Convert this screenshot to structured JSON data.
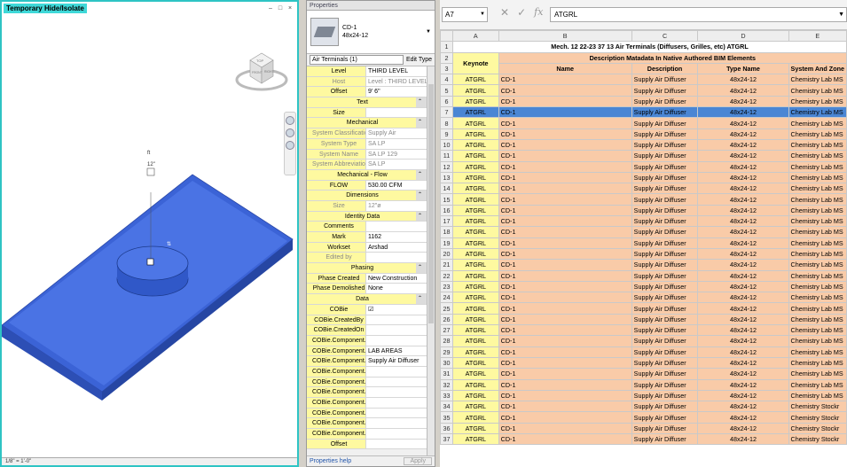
{
  "view": {
    "title": "Temporary Hide/Isolate",
    "controls": [
      "–",
      "□",
      "×"
    ],
    "status": "1/8\" = 1'-0\"",
    "tag_label": "ft",
    "tag_value": "12\""
  },
  "props": {
    "header": "Properties",
    "type_name": "CD-1",
    "type_size": "48x24-12",
    "instance_filter": "Air Terminals (1)",
    "edit_type": "Edit Type",
    "help": "Properties help",
    "apply": "Apply",
    "rows": [
      {
        "k": "Level",
        "v": "THIRD LEVEL"
      },
      {
        "k": "Host",
        "v": "Level : THIRD LEVEL",
        "ro": true
      },
      {
        "k": "Offset",
        "v": "9' 6\""
      },
      {
        "g": "Text"
      },
      {
        "k": "Size",
        "v": ""
      },
      {
        "g": "Mechanical"
      },
      {
        "k": "System Classification",
        "v": "Supply Air",
        "ro": true
      },
      {
        "k": "System Type",
        "v": "SA LP",
        "ro": true
      },
      {
        "k": "System Name",
        "v": "SA LP 129",
        "ro": true
      },
      {
        "k": "System Abbreviation",
        "v": "SA LP",
        "ro": true
      },
      {
        "g": "Mechanical - Flow"
      },
      {
        "k": "FLOW",
        "v": "530.00 CFM"
      },
      {
        "g": "Dimensions"
      },
      {
        "k": "Size",
        "v": "12\"ø",
        "ro": true
      },
      {
        "g": "Identity Data"
      },
      {
        "k": "Comments",
        "v": ""
      },
      {
        "k": "Mark",
        "v": "1162"
      },
      {
        "k": "Workset",
        "v": "Arshad"
      },
      {
        "k": "Edited by",
        "v": "",
        "ro": true
      },
      {
        "g": "Phasing"
      },
      {
        "k": "Phase Created",
        "v": "New Construction"
      },
      {
        "k": "Phase Demolished",
        "v": "None"
      },
      {
        "g": "Data"
      },
      {
        "k": "COBie",
        "v": "☑"
      },
      {
        "k": "COBie.CreatedBy",
        "v": ""
      },
      {
        "k": "COBie.CreatedOn",
        "v": ""
      },
      {
        "k": "COBie.Component....",
        "v": ""
      },
      {
        "k": "COBie.Component.S...",
        "v": "LAB AREAS"
      },
      {
        "k": "COBie.Component....",
        "v": "Supply Air Diffuser"
      },
      {
        "k": "COBie.Component.S...",
        "v": ""
      },
      {
        "k": "COBie.Component.I...",
        "v": ""
      },
      {
        "k": "COBie.Component....",
        "v": ""
      },
      {
        "k": "COBie.Component.T...",
        "v": ""
      },
      {
        "k": "COBie.Component.B...",
        "v": ""
      },
      {
        "k": "COBie.Component....",
        "v": ""
      },
      {
        "k": "COBie.Component....",
        "v": ""
      },
      {
        "k": "Offset",
        "v": ""
      }
    ]
  },
  "excel": {
    "name_box": "A7",
    "formula": "ATGRL",
    "columns": [
      "A",
      "B",
      "C",
      "D",
      "E"
    ],
    "title": "Mech. 12  22-23 37 13 Air Terminals (Diffusers, Grilles, etc)  ATGRL",
    "group_header": "Description Matadata In Native Authored BIM Elements",
    "keynote_header": "Keynote",
    "sub_headers": [
      "Name",
      "Description",
      "Type Name",
      "System And Zone"
    ],
    "selected_row": 7,
    "rows": [
      {
        "n": 4,
        "c": [
          "ATGRL",
          "CD-1",
          "Supply Air Diffuser",
          "48x24-12",
          "Chemistry Lab MS"
        ]
      },
      {
        "n": 5,
        "c": [
          "ATGRL",
          "CD-1",
          "Supply Air Diffuser",
          "48x24-12",
          "Chemistry Lab MS"
        ]
      },
      {
        "n": 6,
        "c": [
          "ATGRL",
          "CD-1",
          "Supply Air Diffuser",
          "48x24-12",
          "Chemistry Lab MS"
        ]
      },
      {
        "n": 7,
        "c": [
          "ATGRL",
          "CD-1",
          "Supply Air Diffuser",
          "48x24-12",
          "Chemistry Lab MS"
        ]
      },
      {
        "n": 8,
        "c": [
          "ATGRL",
          "CD-1",
          "Supply Air Diffuser",
          "48x24-12",
          "Chemistry Lab MS"
        ]
      },
      {
        "n": 9,
        "c": [
          "ATGRL",
          "CD-1",
          "Supply Air Diffuser",
          "48x24-12",
          "Chemistry Lab MS"
        ]
      },
      {
        "n": 10,
        "c": [
          "ATGRL",
          "CD-1",
          "Supply Air Diffuser",
          "48x24-12",
          "Chemistry Lab MS"
        ]
      },
      {
        "n": 11,
        "c": [
          "ATGRL",
          "CD-1",
          "Supply Air Diffuser",
          "48x24-12",
          "Chemistry Lab MS"
        ]
      },
      {
        "n": 12,
        "c": [
          "ATGRL",
          "CD-1",
          "Supply Air Diffuser",
          "48x24-12",
          "Chemistry Lab MS"
        ]
      },
      {
        "n": 13,
        "c": [
          "ATGRL",
          "CD-1",
          "Supply Air Diffuser",
          "48x24-12",
          "Chemistry Lab MS"
        ]
      },
      {
        "n": 14,
        "c": [
          "ATGRL",
          "CD-1",
          "Supply Air Diffuser",
          "48x24-12",
          "Chemistry Lab MS"
        ]
      },
      {
        "n": 15,
        "c": [
          "ATGRL",
          "CD-1",
          "Supply Air Diffuser",
          "48x24-12",
          "Chemistry Lab MS"
        ]
      },
      {
        "n": 16,
        "c": [
          "ATGRL",
          "CD-1",
          "Supply Air Diffuser",
          "48x24-12",
          "Chemistry Lab MS"
        ]
      },
      {
        "n": 17,
        "c": [
          "ATGRL",
          "CD-1",
          "Supply Air Diffuser",
          "48x24-12",
          "Chemistry Lab MS"
        ]
      },
      {
        "n": 18,
        "c": [
          "ATGRL",
          "CD-1",
          "Supply Air Diffuser",
          "48x24-12",
          "Chemistry Lab MS"
        ]
      },
      {
        "n": 19,
        "c": [
          "ATGRL",
          "CD-1",
          "Supply Air Diffuser",
          "48x24-12",
          "Chemistry Lab MS"
        ]
      },
      {
        "n": 20,
        "c": [
          "ATGRL",
          "CD-1",
          "Supply Air Diffuser",
          "48x24-12",
          "Chemistry Lab MS"
        ]
      },
      {
        "n": 21,
        "c": [
          "ATGRL",
          "CD-1",
          "Supply Air Diffuser",
          "48x24-12",
          "Chemistry Lab MS"
        ]
      },
      {
        "n": 22,
        "c": [
          "ATGRL",
          "CD-1",
          "Supply Air Diffuser",
          "48x24-12",
          "Chemistry Lab MS"
        ]
      },
      {
        "n": 23,
        "c": [
          "ATGRL",
          "CD-1",
          "Supply Air Diffuser",
          "48x24-12",
          "Chemistry Lab MS"
        ]
      },
      {
        "n": 24,
        "c": [
          "ATGRL",
          "CD-1",
          "Supply Air Diffuser",
          "48x24-12",
          "Chemistry Lab MS"
        ]
      },
      {
        "n": 25,
        "c": [
          "ATGRL",
          "CD-1",
          "Supply Air Diffuser",
          "48x24-12",
          "Chemistry Lab MS"
        ]
      },
      {
        "n": 26,
        "c": [
          "ATGRL",
          "CD-1",
          "Supply Air Diffuser",
          "48x24-12",
          "Chemistry Lab MS"
        ]
      },
      {
        "n": 27,
        "c": [
          "ATGRL",
          "CD-1",
          "Supply Air Diffuser",
          "48x24-12",
          "Chemistry Lab MS"
        ]
      },
      {
        "n": 28,
        "c": [
          "ATGRL",
          "CD-1",
          "Supply Air Diffuser",
          "48x24-12",
          "Chemistry Lab MS"
        ]
      },
      {
        "n": 29,
        "c": [
          "ATGRL",
          "CD-1",
          "Supply Air Diffuser",
          "48x24-12",
          "Chemistry Lab MS"
        ]
      },
      {
        "n": 30,
        "c": [
          "ATGRL",
          "CD-1",
          "Supply Air Diffuser",
          "48x24-12",
          "Chemistry Lab MS"
        ]
      },
      {
        "n": 31,
        "c": [
          "ATGRL",
          "CD-1",
          "Supply Air Diffuser",
          "48x24-12",
          "Chemistry Lab MS"
        ]
      },
      {
        "n": 32,
        "c": [
          "ATGRL",
          "CD-1",
          "Supply Air Diffuser",
          "48x24-12",
          "Chemistry Lab MS"
        ]
      },
      {
        "n": 33,
        "c": [
          "ATGRL",
          "CD-1",
          "Supply Air Diffuser",
          "48x24-12",
          "Chemistry Lab MS"
        ]
      },
      {
        "n": 34,
        "c": [
          "ATGRL",
          "CD-1",
          "Supply Air Diffuser",
          "48x24-12",
          "Chemistry Stockr"
        ]
      },
      {
        "n": 35,
        "c": [
          "ATGRL",
          "CD-1",
          "Supply Air Diffuser",
          "48x24-12",
          "Chemistry Stockr"
        ]
      },
      {
        "n": 36,
        "c": [
          "ATGRL",
          "CD-1",
          "Supply Air Diffuser",
          "48x24-12",
          "Chemistry Stockr"
        ]
      },
      {
        "n": 37,
        "c": [
          "ATGRL",
          "CD-1",
          "Supply Air Diffuser",
          "48x24-12",
          "Chemistry Stockr"
        ]
      }
    ]
  },
  "colors": {
    "view_border": "#2ec4c4",
    "model_blue": "#3b63d6",
    "keynote_yellow": "#fef9a0",
    "data_orange": "#f9cba8",
    "selection_blue": "#4a86d4"
  }
}
